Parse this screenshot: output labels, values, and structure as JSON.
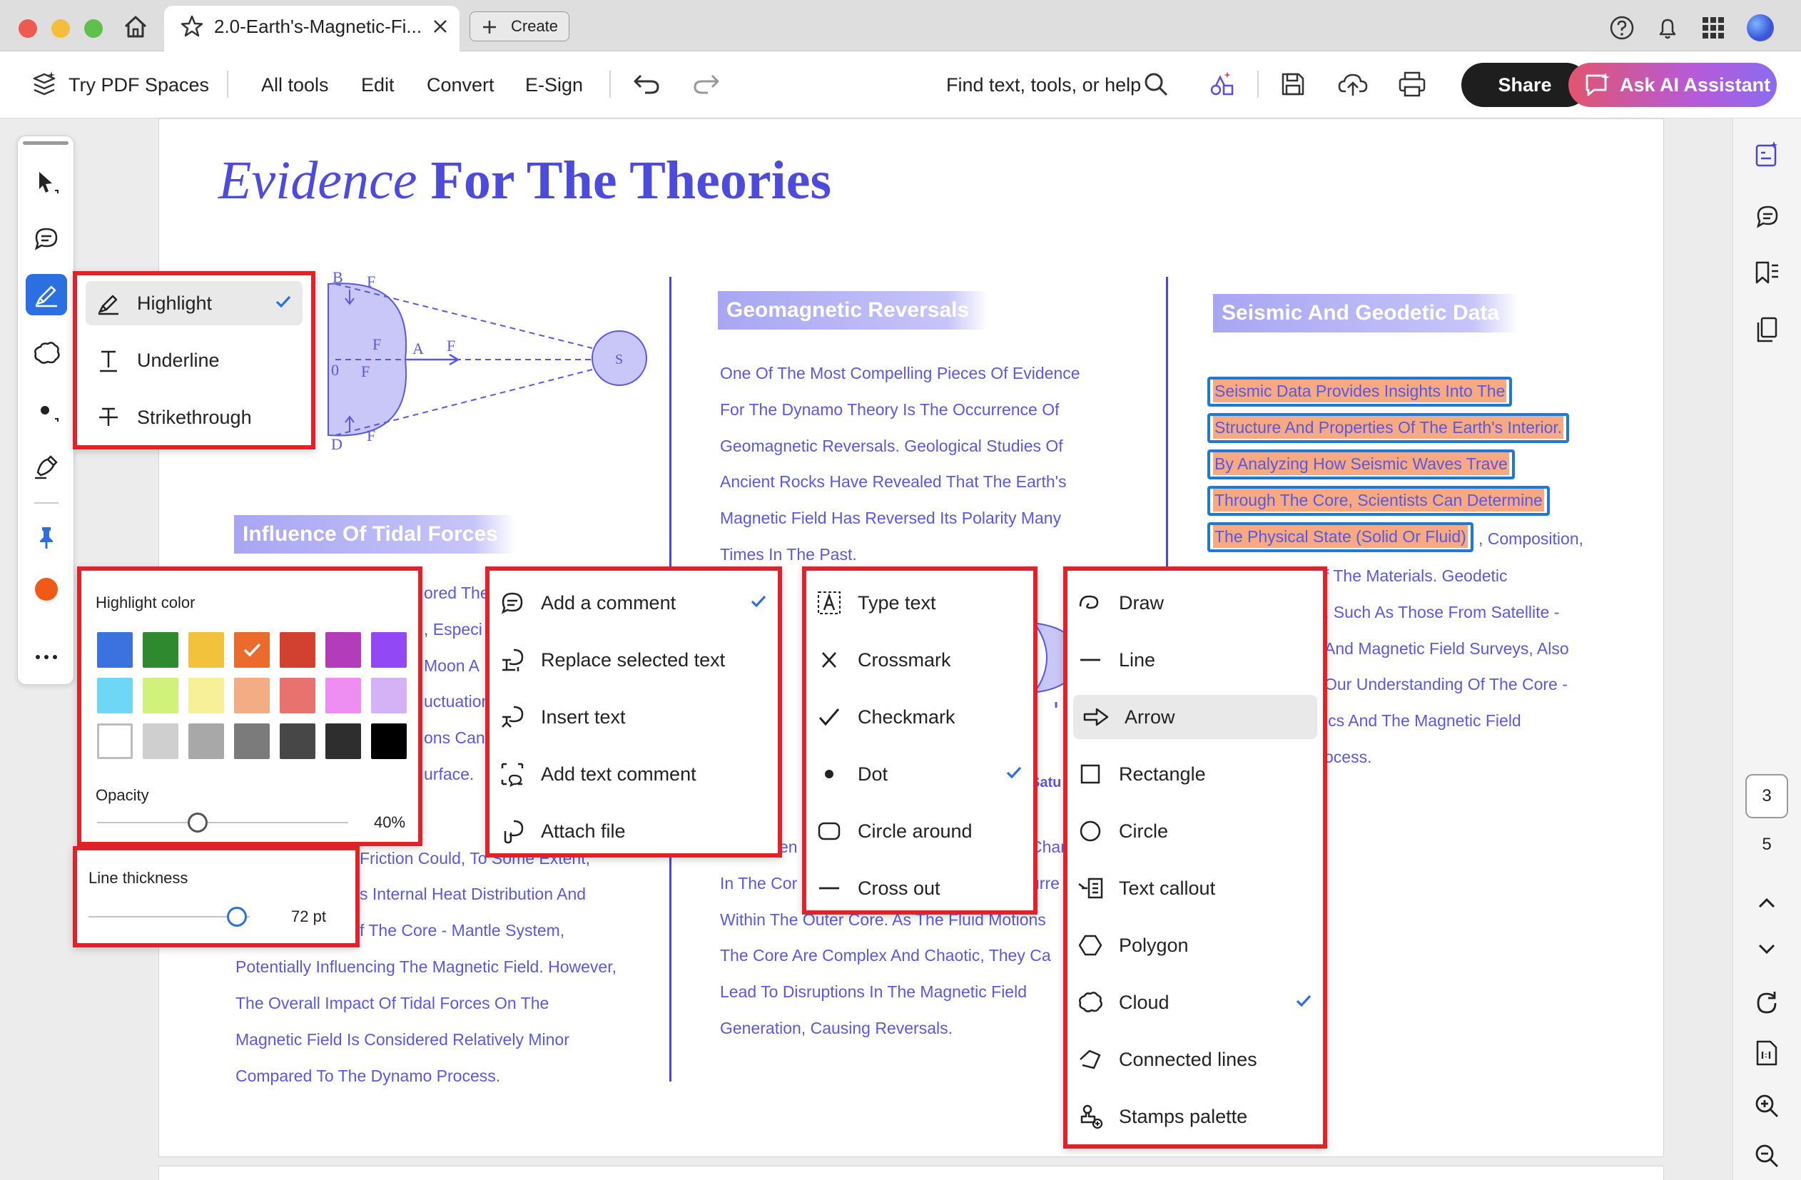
{
  "tab": {
    "title": "2.0-Earth's-Magnetic-Fi...",
    "create_label": "Create"
  },
  "toolbar": {
    "try_pdf_spaces": "Try PDF Spaces",
    "all_tools": "All tools",
    "edit": "Edit",
    "convert": "Convert",
    "esign": "E-Sign",
    "search_placeholder": "Find text, tools, or help",
    "share": "Share",
    "ai_assistant": "Ask AI Assistant"
  },
  "document": {
    "heading_italic": "Evidence",
    "heading_bold": "For The Theories",
    "diagram_labels": {
      "b": "B",
      "d": "D",
      "a": "A",
      "zero": "0",
      "s": "S",
      "fg": "F",
      "fr": "F"
    },
    "sections": {
      "tidal": {
        "title": "Influence Of Tidal Forces",
        "partial_lines": [
          "ored The",
          ", Especi",
          "Moon A",
          "uctuation",
          "ons Can",
          "urface."
        ],
        "lines": [
          "Friction Could, To Some Extent,",
          "s Internal Heat Distribution And",
          "f The Core - Mantle System,",
          "Potentially Influencing The Magnetic Field. However,",
          "The Overall Impact Of Tidal Forces On The",
          "Magnetic Field Is Considered Relatively Minor",
          "Compared To The Dynamo Process."
        ]
      },
      "geomagnetic": {
        "title": "Geomagnetic Reversals",
        "lines": [
          "One Of The Most Compelling Pieces Of Evidence",
          "For The Dynamo Theory Is The Occurrence Of",
          "Geomagnetic Reversals. Geological Studies Of",
          "Ancient Rocks Have Revealed That The Earth's",
          "Magnetic Field Has Reversed Its Polarity Many",
          "Times In The Past."
        ],
        "lines_lower": [
          "In The Cor",
          "Within The Outer Core. As The Fluid Motions",
          "The Core Are Complex And Chaotic, They Ca",
          "Lead To Disruptions In The Magnetic Field",
          "Generation, Causing Reversals."
        ],
        "partial_right": [
          "Char",
          "urre"
        ],
        "partial_left": "en"
      },
      "seismic": {
        "title": "Seismic And Geodetic Data",
        "highlighted": [
          "Seismic Data Provides Insights Into The",
          "Structure And Properties Of The Earth's Interior.",
          "By Analyzing How Seismic Waves Trave",
          "Through The Core, Scientists Can Determine",
          "The Physical State (Solid Or Fluid)"
        ],
        "after_highlight": ", Composition,",
        "lines": [
          "f The Materials. Geodetic",
          ", Such As Those From Satellite -",
          "And Magnetic Field Surveys, Also",
          "Our Understanding Of The Core -",
          "ics And The Magnetic Field",
          "ocess."
        ]
      }
    },
    "saturn_partial": "Satu"
  },
  "menus": {
    "highlight": {
      "items": [
        {
          "label": "Highlight",
          "icon": "highlighter-icon",
          "checked": true
        },
        {
          "label": "Underline",
          "icon": "underline-icon",
          "checked": false
        },
        {
          "label": "Strikethrough",
          "icon": "strikethrough-icon",
          "checked": false
        }
      ]
    },
    "color_panel": {
      "title": "Highlight color",
      "colors": [
        "#3b72e0",
        "#2f8a2f",
        "#f2c23c",
        "#ea6b2c",
        "#d2402f",
        "#b33cba",
        "#9348f5",
        "#6fd7f6",
        "#d1f27a",
        "#f8f098",
        "#f2ad84",
        "#e8736e",
        "#ee8ef2",
        "#d4b2f5",
        "#ffffff",
        "#cfcfcf",
        "#a8a8a8",
        "#7b7b7b",
        "#474747",
        "#2e2e2e",
        "#000000"
      ],
      "selected_color": "#ea6b2c",
      "opacity_label": "Opacity",
      "opacity_value": "40%",
      "opacity_fraction": 0.4
    },
    "thickness": {
      "label": "Line thickness",
      "value": "72 pt",
      "fraction": 0.92
    },
    "comment": {
      "items": [
        {
          "label": "Add a comment",
          "icon": "comment-icon",
          "checked": true
        },
        {
          "label": "Replace selected text",
          "icon": "replace-text-icon",
          "checked": false
        },
        {
          "label": "Insert text",
          "icon": "insert-text-icon",
          "checked": false
        },
        {
          "label": "Add text comment",
          "icon": "text-comment-icon",
          "checked": false
        },
        {
          "label": "Attach file",
          "icon": "attach-file-icon",
          "checked": false
        }
      ]
    },
    "text_marks": {
      "items": [
        {
          "label": "Type text",
          "icon": "type-text-icon",
          "checked": false
        },
        {
          "label": "Crossmark",
          "icon": "crossmark-icon",
          "checked": false
        },
        {
          "label": "Checkmark",
          "icon": "checkmark-icon",
          "checked": false
        },
        {
          "label": "Dot",
          "icon": "dot-icon",
          "checked": true
        },
        {
          "label": "Circle around",
          "icon": "circle-around-icon",
          "checked": false
        },
        {
          "label": "Cross out",
          "icon": "cross-out-icon",
          "checked": false
        }
      ]
    },
    "shapes": {
      "items": [
        {
          "label": "Draw",
          "icon": "draw-icon",
          "checked": false
        },
        {
          "label": "Line",
          "icon": "line-icon",
          "checked": false
        },
        {
          "label": "Arrow",
          "icon": "arrow-icon",
          "checked": false,
          "hovered": true
        },
        {
          "label": "Rectangle",
          "icon": "rectangle-icon",
          "checked": false
        },
        {
          "label": "Circle",
          "icon": "circle-icon",
          "checked": false
        },
        {
          "label": "Text callout",
          "icon": "text-callout-icon",
          "checked": false
        },
        {
          "label": "Polygon",
          "icon": "polygon-icon",
          "checked": false
        },
        {
          "label": "Cloud",
          "icon": "cloud-icon",
          "checked": true
        },
        {
          "label": "Connected lines",
          "icon": "connected-lines-icon",
          "checked": false
        },
        {
          "label": "Stamps palette",
          "icon": "stamps-icon",
          "checked": false
        }
      ]
    }
  },
  "pagination": {
    "current": "3",
    "total": "5"
  },
  "colors": {
    "accent": "#2c6fe0",
    "highlight_border": "#e0232b",
    "text_blue": "#5b58e0",
    "rail_color": "#f05a16"
  }
}
